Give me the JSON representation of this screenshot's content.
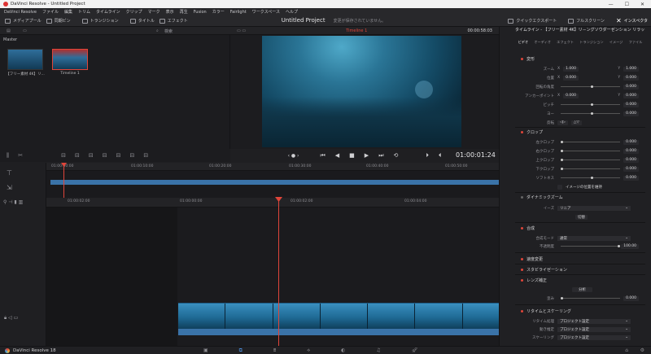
{
  "window": {
    "title": "DaVinci Resolve - Untitled Project",
    "controls": [
      "—",
      "☐",
      "✕"
    ]
  },
  "menubar": [
    "DaVinci Resolve",
    "ファイル",
    "編集",
    "トリム",
    "タイムライン",
    "クリップ",
    "マーク",
    "表示",
    "再生",
    "Fusion",
    "カラー",
    "Fairlight",
    "ワークスペース",
    "ヘルプ"
  ],
  "toolbar": {
    "media_pool": "メディアプール",
    "sync_bin": "同期ビン",
    "transitions": "トランジション",
    "titles": "タイトル",
    "effects": "エフェクト",
    "quick_export": "クイックエクスポート",
    "fullscreen": "フルスクリーン",
    "inspector": "インスペクタ"
  },
  "project": {
    "name": "Untitled Project",
    "status": "変更が保存されていません。"
  },
  "subbar": {
    "search": "検索"
  },
  "media_pool": {
    "bin": "Master",
    "clips": [
      {
        "label": "【フリー素材 4K】リ..."
      },
      {
        "label": "Timeline 1"
      }
    ]
  },
  "viewer": {
    "timeline_name": "Timeline 1",
    "timecode": "00:00:58:03",
    "current_timecode": "01:00:01:24"
  },
  "timeline": {
    "upper_ruler": [
      "01:00:00:00",
      "01:00:10:00",
      "01:00:20:00",
      "01:00:30:00",
      "01:00:40:00",
      "01:00:50:00"
    ],
    "lower_ruler": [
      "01:00:02:00",
      "01:00:00:00",
      "01:00:02:00",
      "01:00:04:00"
    ]
  },
  "inspector": {
    "clip_title": "タイムライン - 【フリー素材 4K】リ－ングソウダーゼンション リラックス.mp4",
    "tabs": [
      "ビデオ",
      "オーディオ",
      "エフェクト",
      "トランジション",
      "イメージ",
      "ファイル"
    ],
    "transform": {
      "title": "変形",
      "zoom_label": "ズーム",
      "zoom_x": "1.000",
      "zoom_y": "1.000",
      "position_label": "位置",
      "position_x": "0.000",
      "position_y": "0.000",
      "rotation_label": "回転の角度",
      "rotation": "0.000",
      "anchor_label": "アンカーポイント",
      "anchor_x": "0.000",
      "anchor_y": "0.000",
      "pitch_label": "ピッチ",
      "pitch": "0.000",
      "yaw_label": "ヨー",
      "yaw": "0.000",
      "flip_label": "反転"
    },
    "cropping": {
      "title": "クロップ",
      "left_label": "左クロップ",
      "left": "0.000",
      "right_label": "右クロップ",
      "right": "0.000",
      "top_label": "上クロップ",
      "top": "0.000",
      "bottom_label": "下クロップ",
      "bottom": "0.000",
      "softness_label": "ソフトネス",
      "softness": "0.000",
      "retain_label": "イメージの位置を維持"
    },
    "dynamic_zoom": {
      "title": "ダイナミックズーム",
      "ease_label": "イーズ",
      "ease": "リニア",
      "swap": "切替"
    },
    "composite": {
      "title": "合成",
      "mode_label": "合成モード",
      "mode": "通常",
      "opacity_label": "不透明度",
      "opacity": "100.00"
    },
    "speed": {
      "title": "速度変更"
    },
    "stabilization": {
      "title": "スタビライゼーション"
    },
    "lens": {
      "title": "レンズ補正",
      "analyze": "分析",
      "distortion_label": "歪み",
      "distortion": "0.000"
    },
    "retime": {
      "title": "リタイムとスケーリング",
      "retime_process_label": "リタイム処理",
      "retime_process": "プロジェクト設定",
      "motion_est_label": "動き推定",
      "motion_est": "プロジェクト設定",
      "scaling_label": "スケーリング",
      "scaling": "プロジェクト設定"
    }
  },
  "status": {
    "brand": "DaVinci Resolve 18"
  },
  "colors": {
    "accent_red": "#e0453a",
    "clip_blue": "#3a73a8",
    "active_blue": "#4d8fe0"
  }
}
